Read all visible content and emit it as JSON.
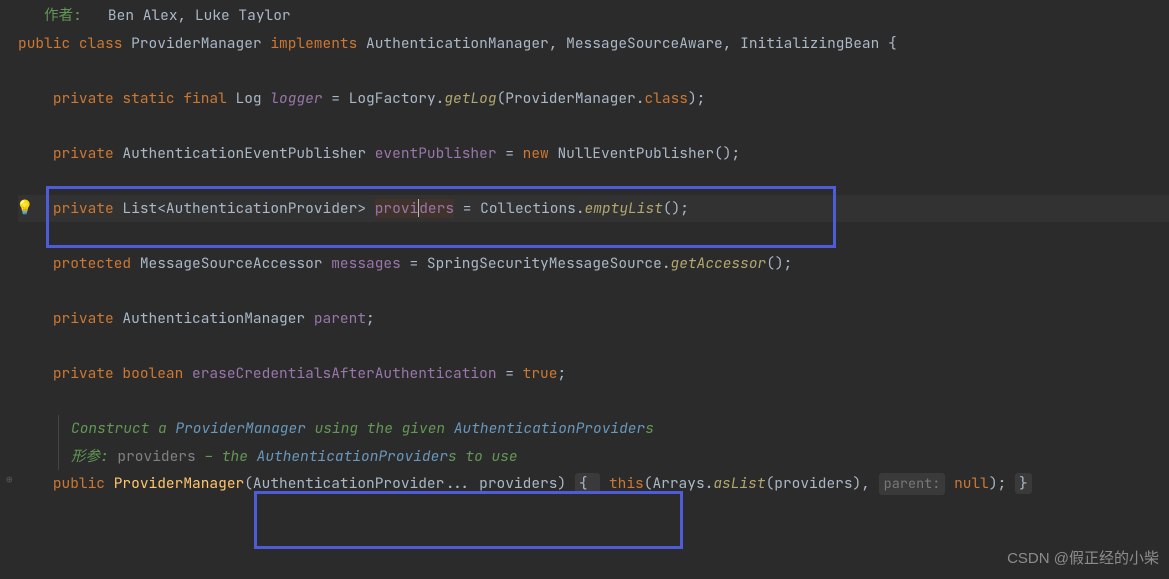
{
  "header": {
    "author_label": "作者:",
    "authors": "Ben Alex, Luke Taylor"
  },
  "code": {
    "l1_public": "public ",
    "l1_class": "class ",
    "l1_name": "ProviderManager ",
    "l1_impl": "implements ",
    "l1_ifs": "AuthenticationManager, MessageSourceAware, InitializingBean {",
    "l2_priv": "private ",
    "l2_static": "static ",
    "l2_final": "final ",
    "l2_type": "Log ",
    "l2_field": "logger",
    "l2_eq": " = LogFactory.",
    "l2_m": "getLog",
    "l2_tail": "(ProviderManager.",
    "l2_cls": "class",
    "l2_end": ");",
    "l3_priv": "private ",
    "l3_type": "AuthenticationEventPublisher ",
    "l3_field": "eventPublisher",
    "l3_eq": " = ",
    "l3_new": "new ",
    "l3_ctor": "NullEventPublisher();",
    "l4_priv": "private ",
    "l4_type": "List<AuthenticationProvider> ",
    "l4_field_a": "provi",
    "l4_field_b": "ders",
    "l4_eq": " = Collections.",
    "l4_m": "emptyList",
    "l4_end": "();",
    "l5_prot": "protected ",
    "l5_type": "MessageSourceAccessor ",
    "l5_field": "messages",
    "l5_eq": " = SpringSecurityMessageSource.",
    "l5_m": "getAccessor",
    "l5_end": "();",
    "l6_priv": "private ",
    "l6_type": "AuthenticationManager ",
    "l6_field": "parent",
    "l6_end": ";",
    "l7_priv": "private ",
    "l7_type": "boolean ",
    "l7_field": "eraseCredentialsAfterAuthentication",
    "l7_eq": " = ",
    "l7_val": "true",
    "l7_end": ";",
    "doc1_a": "Construct a ",
    "doc1_b": "ProviderManager",
    "doc1_c": " using the given ",
    "doc1_d": "AuthenticationProvider",
    "doc1_e": "s",
    "doc2_a": "形参: ",
    "doc2_b": "providers",
    "doc2_c": " – the ",
    "doc2_d": "AuthenticationProvider",
    "doc2_e": "s to use",
    "l8_pub": "public ",
    "l8_ctor": "ProviderManager",
    "l8_args": "(AuthenticationProvider... providers) ",
    "l8_open": "{ ",
    "l8_this": "this",
    "l8_call": "(Arrays.",
    "l8_m": "asList",
    "l8_mid": "(providers), ",
    "l8_hint": "parent:",
    "l8_null": " null",
    "l8_end": "); ",
    "l8_close": "}"
  },
  "watermark": "CSDN @假正经的小柴"
}
